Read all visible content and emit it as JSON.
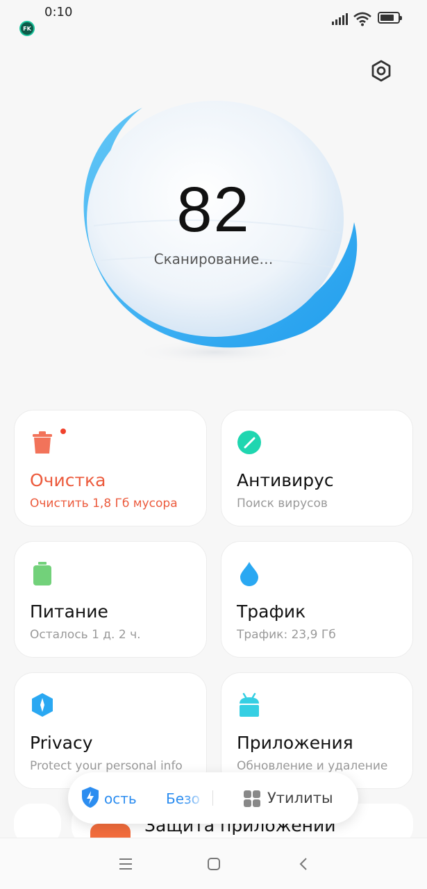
{
  "status": {
    "time": "0:10",
    "app_badge": "FK"
  },
  "hero": {
    "score": "82",
    "status": "Сканирование…"
  },
  "cards": [
    {
      "title": "Очистка",
      "subtitle": "Очистить 1,8 Гб мусора",
      "icon": "trash-icon",
      "color": "#f2735a"
    },
    {
      "title": "Антивирус",
      "subtitle": "Поиск вирусов",
      "icon": "antivirus-icon",
      "color": "#1fd6b0"
    },
    {
      "title": "Питание",
      "subtitle": "Осталось 1 д. 2 ч.",
      "icon": "battery-icon",
      "color": "#72d17a"
    },
    {
      "title": "Трафик",
      "subtitle": "Трафик: 23,9 Гб",
      "icon": "drop-icon",
      "color": "#2aa8f2"
    },
    {
      "title": "Privacy",
      "subtitle": "Protect your personal info",
      "icon": "privacy-icon",
      "color": "#2aa8f2"
    },
    {
      "title": "Приложения",
      "subtitle": "Обновление и удаление",
      "icon": "android-icon",
      "color": "#35cfe3"
    }
  ],
  "partial_row": {
    "title": "Защита приложений"
  },
  "tabs": {
    "tab1": "ость",
    "tab2": "Безо",
    "tab3": "Утилиты"
  },
  "colors": {
    "accent": "#2c8df0",
    "alert": "#ec5a3c",
    "ring": "#2aa8f2"
  }
}
